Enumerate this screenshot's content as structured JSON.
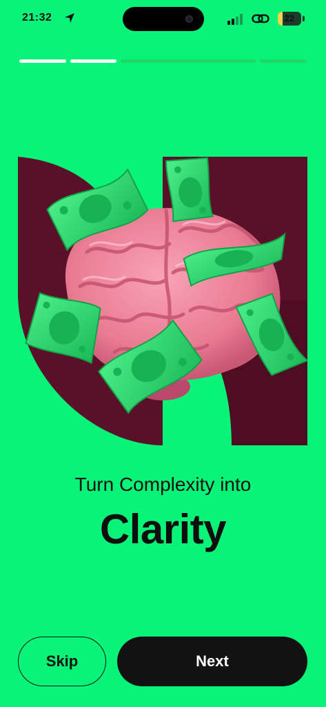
{
  "status_bar": {
    "time": "21:32",
    "battery_level": "22",
    "battery_fraction": 0.22,
    "icons": [
      "location-arrow-icon",
      "cellular-signal-icon",
      "link-icon",
      "battery-icon"
    ]
  },
  "progress": {
    "total_steps": 4,
    "completed_steps": 2,
    "colors": {
      "completed": "#ffffff",
      "pending": "#1dd866"
    }
  },
  "illustration": {
    "subject": "pink brain with green dollar bills on maroon shapes",
    "colors": {
      "background_shape": "#5a1028",
      "brain": "#f08aa0",
      "bill": "#27d86a"
    }
  },
  "headline": {
    "subtitle": "Turn Complexity into",
    "title": "Clarity"
  },
  "buttons": {
    "skip_label": "Skip",
    "next_label": "Next"
  },
  "colors": {
    "background": "#07f478",
    "primary_dark": "#121212",
    "text": "#111111"
  }
}
